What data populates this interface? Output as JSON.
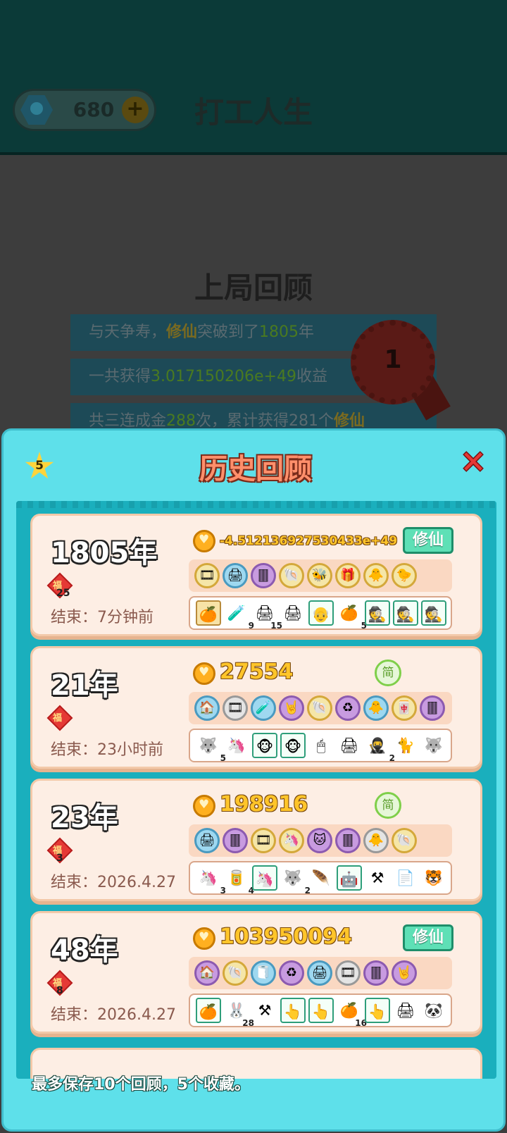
{
  "header": {
    "gem_count": "680",
    "plus_label": "+",
    "title": "打工人生"
  },
  "review": {
    "title": "上局回顾",
    "line1": {
      "prefix": "与天争寿，",
      "keyword": "修仙",
      "middle": "突破到了",
      "years": "1805",
      "suffix": "年"
    },
    "line2": {
      "prefix": "一共获得",
      "value": "3.017150206e+49",
      "suffix": "收益"
    },
    "line3": {
      "prefix": "共三连成金",
      "count": "288",
      "middle": "次，累计获得",
      "count2": "281",
      "suffix": "个",
      "tail": "修仙"
    },
    "medal_rank": "1"
  },
  "modal": {
    "title": "历史回顾",
    "star_count": "5",
    "close_label": "✕",
    "footer": "最多保存10个回顾，5个收藏。",
    "cards": [
      {
        "year": "1805年",
        "fu_label": "福",
        "fu_count": "25",
        "end": "结束：7分钟前",
        "earnings": "-4.51213692753043​3e+49",
        "tag_type": "xiuxian",
        "tag": "修仙",
        "icons": [
          "🎞",
          "🖨",
          "🀫",
          "🐚",
          "🐝",
          "🎁",
          "🐥",
          "🐤"
        ],
        "icon_styles": [
          "",
          "blue",
          "purple",
          "",
          "",
          "",
          "",
          ""
        ],
        "items": [
          {
            "icon": "🍊",
            "count": "",
            "box": "boxed-y"
          },
          {
            "icon": "🧪",
            "count": "9",
            "box": ""
          },
          {
            "icon": "🖨",
            "count": "15",
            "box": ""
          },
          {
            "icon": "🖨",
            "count": "",
            "box": ""
          },
          {
            "icon": "👴",
            "count": "",
            "box": "boxed"
          },
          {
            "icon": "🍊",
            "count": "5",
            "box": ""
          },
          {
            "icon": "🕵",
            "count": "",
            "box": "boxed"
          },
          {
            "icon": "🕵",
            "count": "",
            "box": "boxed"
          },
          {
            "icon": "🕵",
            "count": "",
            "box": "boxed"
          }
        ]
      },
      {
        "year": "21年",
        "fu_label": "福",
        "fu_count": "",
        "end": "结束：23小时前",
        "earnings": "27554",
        "tag_type": "jian",
        "tag": "简",
        "icons": [
          "🏠",
          "🎞",
          "🧪",
          "🤘",
          "🐚",
          "♻",
          "🐥",
          "🀄",
          "🀫"
        ],
        "icon_styles": [
          "blue",
          "gray",
          "blue",
          "purple",
          "",
          "purple",
          "blue",
          "",
          "purple"
        ],
        "items": [
          {
            "icon": "🐺",
            "count": "5",
            "box": ""
          },
          {
            "icon": "🦄",
            "count": "",
            "box": ""
          },
          {
            "icon": "🐵",
            "count": "",
            "box": "boxed"
          },
          {
            "icon": "🐵",
            "count": "",
            "box": "boxed"
          },
          {
            "icon": "🖱",
            "count": "",
            "box": ""
          },
          {
            "icon": "🖨",
            "count": "",
            "box": ""
          },
          {
            "icon": "🥷",
            "count": "2",
            "box": ""
          },
          {
            "icon": "🐈",
            "count": "",
            "box": ""
          },
          {
            "icon": "🐺",
            "count": "",
            "box": ""
          }
        ]
      },
      {
        "year": "23年",
        "fu_label": "福",
        "fu_count": "3",
        "end": "结束：2026.4.27",
        "earnings": "198916",
        "tag_type": "jian",
        "tag": "简",
        "icons": [
          "🖨",
          "🀫",
          "🎞",
          "🦄",
          "🐱",
          "🀫",
          "🐥",
          "🐚"
        ],
        "icon_styles": [
          "blue",
          "purple",
          "",
          "",
          "purple",
          "purple",
          "gray",
          ""
        ],
        "items": [
          {
            "icon": "🦄",
            "count": "3",
            "box": ""
          },
          {
            "icon": "🥫",
            "count": "4",
            "box": ""
          },
          {
            "icon": "🦄",
            "count": "",
            "box": "boxed"
          },
          {
            "icon": "🐺",
            "count": "2",
            "box": ""
          },
          {
            "icon": "🪶",
            "count": "",
            "box": ""
          },
          {
            "icon": "🤖",
            "count": "",
            "box": "boxed"
          },
          {
            "icon": "⚒",
            "count": "",
            "box": ""
          },
          {
            "icon": "📄",
            "count": "",
            "box": ""
          },
          {
            "icon": "🐯",
            "count": "",
            "box": ""
          }
        ]
      },
      {
        "year": "48年",
        "fu_label": "福",
        "fu_count": "8",
        "end": "结束：2026.4.27",
        "earnings": "103950094",
        "tag_type": "xiuxian",
        "tag": "修仙",
        "icons": [
          "🏠",
          "🐚",
          "🧻",
          "♻",
          "🖨",
          "🎞",
          "🀫",
          "🤘"
        ],
        "icon_styles": [
          "purple",
          "",
          "blue",
          "purple",
          "blue",
          "gray",
          "purple",
          "purple"
        ],
        "items": [
          {
            "icon": "🍊",
            "count": "",
            "box": "boxed"
          },
          {
            "icon": "🐰",
            "count": "28",
            "box": ""
          },
          {
            "icon": "⚒",
            "count": "",
            "box": ""
          },
          {
            "icon": "👆",
            "count": "",
            "box": "boxed"
          },
          {
            "icon": "👆",
            "count": "",
            "box": "boxed"
          },
          {
            "icon": "🍊",
            "count": "16",
            "box": ""
          },
          {
            "icon": "👆",
            "count": "",
            "box": "boxed"
          },
          {
            "icon": "🖨",
            "count": "",
            "box": ""
          },
          {
            "icon": "🐼",
            "count": "",
            "box": ""
          }
        ]
      }
    ]
  },
  "colors": {
    "modal_bg": "#5ee0ea",
    "list_bg": "#1aafbd",
    "card_bg": "#fdeee4",
    "accent_coin": "#ffc52a",
    "tag_green": "#5ee0b6"
  }
}
